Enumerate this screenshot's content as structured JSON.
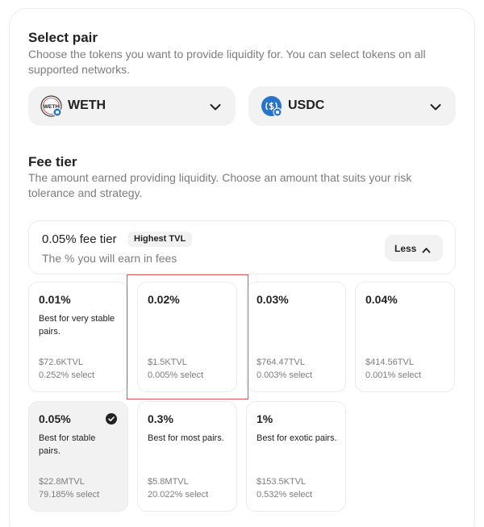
{
  "select_pair": {
    "title": "Select pair",
    "description": "Choose the tokens you want to provide liquidity for. You can select tokens on all supported networks.",
    "token_a": {
      "symbol": "WETH",
      "icon": "weth-token-icon",
      "icon_text": "WETH"
    },
    "token_b": {
      "symbol": "USDC",
      "icon": "usdc-token-icon"
    }
  },
  "fee_tier": {
    "title": "Fee tier",
    "description": "The amount earned providing liquidity. Choose an amount that suits your risk tolerance and strategy.",
    "current": {
      "label": "0.05% fee tier",
      "badge": "Highest TVL",
      "subtitle": "The % you will earn in fees",
      "toggle_label": "Less"
    },
    "options": [
      {
        "pct": "0.01%",
        "desc": "Best for very stable pairs.",
        "tvl": "$72.6KTVL",
        "select": "0.252% select"
      },
      {
        "pct": "0.02%",
        "desc": "",
        "tvl": "$1.5KTVL",
        "select": "0.005% select"
      },
      {
        "pct": "0.03%",
        "desc": "",
        "tvl": "$764.47TVL",
        "select": "0.003% select"
      },
      {
        "pct": "0.04%",
        "desc": "",
        "tvl": "$414.56TVL",
        "select": "0.001% select"
      },
      {
        "pct": "0.05%",
        "desc": "Best for stable pairs.",
        "tvl": "$22.8MTVL",
        "select": "79.185% select",
        "selected": true
      },
      {
        "pct": "0.3%",
        "desc": "Best for most pairs.",
        "tvl": "$5.8MTVL",
        "select": "20.022% select"
      },
      {
        "pct": "1%",
        "desc": "Best for exotic pairs.",
        "tvl": "$153.5KTVL",
        "select": "0.532% select"
      }
    ]
  },
  "colors": {
    "text": "#222222",
    "muted": "#7d7d7d",
    "surface": "#f2f2f2",
    "border": "#ececec",
    "usdc_blue": "#2775ca",
    "highlight": "#e2535a"
  }
}
